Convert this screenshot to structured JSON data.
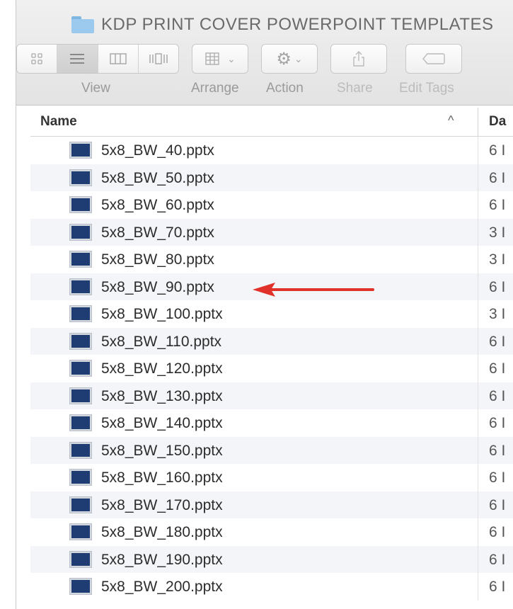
{
  "window": {
    "title": "KDP PRINT COVER POWERPOINT TEMPLATES"
  },
  "toolbar": {
    "view_label": "View",
    "arrange_label": "Arrange",
    "action_label": "Action",
    "share_label": "Share",
    "edit_tags_label": "Edit Tags",
    "active_view": "list"
  },
  "columns": {
    "name": "Name",
    "date": "Da",
    "sort_indicator": "^"
  },
  "files": [
    {
      "name": "5x8_BW_40.pptx",
      "date": "6 I"
    },
    {
      "name": "5x8_BW_50.pptx",
      "date": "6 I"
    },
    {
      "name": "5x8_BW_60.pptx",
      "date": "6 I"
    },
    {
      "name": "5x8_BW_70.pptx",
      "date": "3 I"
    },
    {
      "name": "5x8_BW_80.pptx",
      "date": "3 I"
    },
    {
      "name": "5x8_BW_90.pptx",
      "date": "6 I"
    },
    {
      "name": "5x8_BW_100.pptx",
      "date": "3 I"
    },
    {
      "name": "5x8_BW_110.pptx",
      "date": "6 I"
    },
    {
      "name": "5x8_BW_120.pptx",
      "date": "6 I"
    },
    {
      "name": "5x8_BW_130.pptx",
      "date": "6 I"
    },
    {
      "name": "5x8_BW_140.pptx",
      "date": "6 I"
    },
    {
      "name": "5x8_BW_150.pptx",
      "date": "6 I"
    },
    {
      "name": "5x8_BW_160.pptx",
      "date": "6 I"
    },
    {
      "name": "5x8_BW_170.pptx",
      "date": "6 I"
    },
    {
      "name": "5x8_BW_180.pptx",
      "date": "6 I"
    },
    {
      "name": "5x8_BW_190.pptx",
      "date": "6 I"
    },
    {
      "name": "5x8_BW_200.pptx",
      "date": "6 I"
    }
  ],
  "annotation": {
    "arrow_color": "#e0322a",
    "points_to": "5x8_BW_90.pptx"
  },
  "colors": {
    "folder": "#9cc9ee",
    "file_icon": "#1f3d73"
  }
}
